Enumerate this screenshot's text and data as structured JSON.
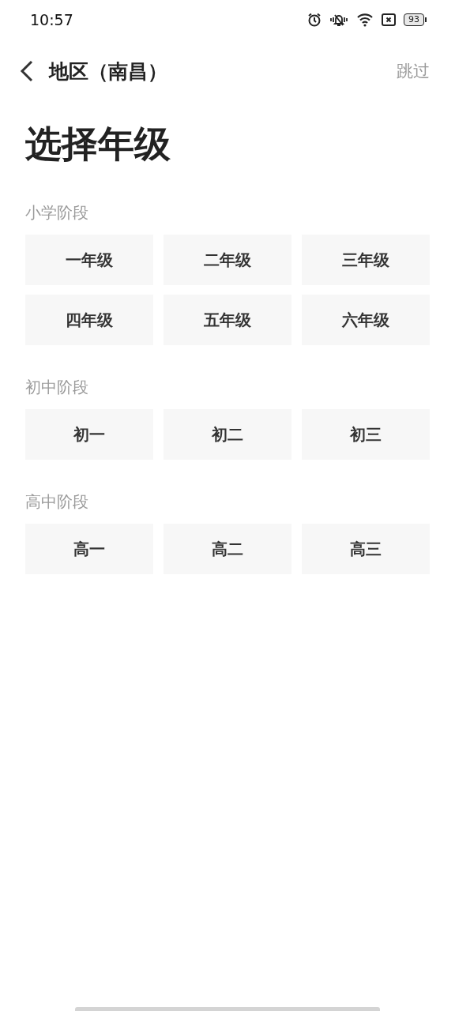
{
  "status_bar": {
    "time": "10:57",
    "battery": "93"
  },
  "nav": {
    "title": "地区（南昌）",
    "action": "跳过"
  },
  "heading": "选择年级",
  "sections": [
    {
      "label": "小学阶段",
      "options": [
        {
          "label": "一年级"
        },
        {
          "label": "二年级"
        },
        {
          "label": "三年级"
        },
        {
          "label": "四年级"
        },
        {
          "label": "五年级"
        },
        {
          "label": "六年级"
        }
      ]
    },
    {
      "label": "初中阶段",
      "options": [
        {
          "label": "初一"
        },
        {
          "label": "初二"
        },
        {
          "label": "初三"
        }
      ]
    },
    {
      "label": "高中阶段",
      "options": [
        {
          "label": "高一"
        },
        {
          "label": "高二"
        },
        {
          "label": "高三"
        }
      ]
    }
  ]
}
